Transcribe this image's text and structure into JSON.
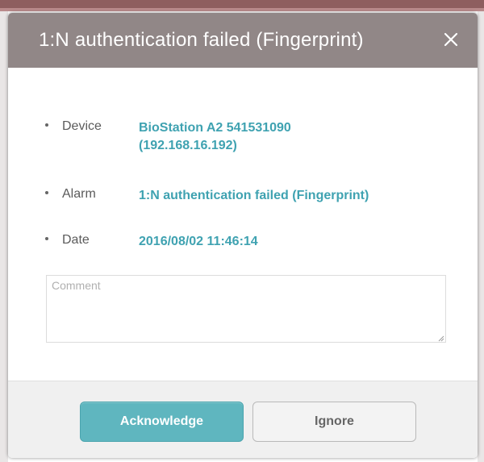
{
  "dialog": {
    "title": "1:N authentication failed (Fingerprint)",
    "close_icon": "close-icon"
  },
  "details": {
    "device": {
      "label": "Device",
      "value_line1": "BioStation A2 541531090",
      "value_line2": "(192.168.16.192)"
    },
    "alarm": {
      "label": "Alarm",
      "value": "1:N authentication failed (Fingerprint)"
    },
    "date": {
      "label": "Date",
      "value": "2016/08/02 11:46:14"
    }
  },
  "comment": {
    "placeholder": "Comment",
    "value": ""
  },
  "footer": {
    "acknowledge_label": "Acknowledge",
    "ignore_label": "Ignore"
  },
  "colors": {
    "header_bg": "#918787",
    "value_text": "#3fa2b1",
    "primary_button": "#5fb6bf",
    "secondary_button": "#f3f3f3"
  }
}
